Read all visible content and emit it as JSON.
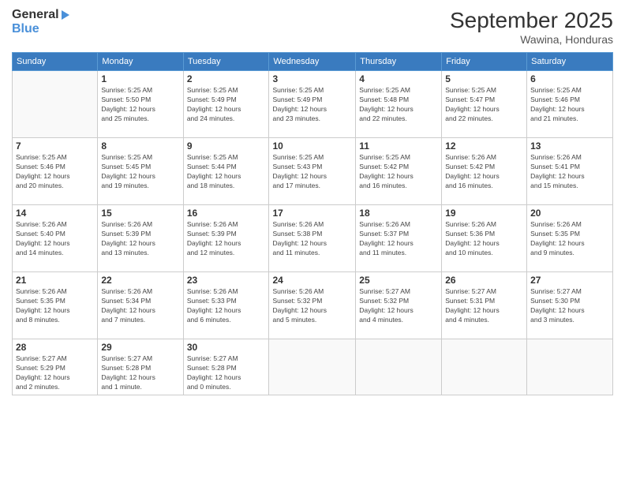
{
  "header": {
    "logo_line1": "General",
    "logo_line2": "Blue",
    "month": "September 2025",
    "location": "Wawina, Honduras"
  },
  "days_of_week": [
    "Sunday",
    "Monday",
    "Tuesday",
    "Wednesday",
    "Thursday",
    "Friday",
    "Saturday"
  ],
  "weeks": [
    [
      {
        "day": "",
        "info": ""
      },
      {
        "day": "1",
        "info": "Sunrise: 5:25 AM\nSunset: 5:50 PM\nDaylight: 12 hours\nand 25 minutes."
      },
      {
        "day": "2",
        "info": "Sunrise: 5:25 AM\nSunset: 5:49 PM\nDaylight: 12 hours\nand 24 minutes."
      },
      {
        "day": "3",
        "info": "Sunrise: 5:25 AM\nSunset: 5:49 PM\nDaylight: 12 hours\nand 23 minutes."
      },
      {
        "day": "4",
        "info": "Sunrise: 5:25 AM\nSunset: 5:48 PM\nDaylight: 12 hours\nand 22 minutes."
      },
      {
        "day": "5",
        "info": "Sunrise: 5:25 AM\nSunset: 5:47 PM\nDaylight: 12 hours\nand 22 minutes."
      },
      {
        "day": "6",
        "info": "Sunrise: 5:25 AM\nSunset: 5:46 PM\nDaylight: 12 hours\nand 21 minutes."
      }
    ],
    [
      {
        "day": "7",
        "info": "Sunrise: 5:25 AM\nSunset: 5:46 PM\nDaylight: 12 hours\nand 20 minutes."
      },
      {
        "day": "8",
        "info": "Sunrise: 5:25 AM\nSunset: 5:45 PM\nDaylight: 12 hours\nand 19 minutes."
      },
      {
        "day": "9",
        "info": "Sunrise: 5:25 AM\nSunset: 5:44 PM\nDaylight: 12 hours\nand 18 minutes."
      },
      {
        "day": "10",
        "info": "Sunrise: 5:25 AM\nSunset: 5:43 PM\nDaylight: 12 hours\nand 17 minutes."
      },
      {
        "day": "11",
        "info": "Sunrise: 5:25 AM\nSunset: 5:42 PM\nDaylight: 12 hours\nand 16 minutes."
      },
      {
        "day": "12",
        "info": "Sunrise: 5:26 AM\nSunset: 5:42 PM\nDaylight: 12 hours\nand 16 minutes."
      },
      {
        "day": "13",
        "info": "Sunrise: 5:26 AM\nSunset: 5:41 PM\nDaylight: 12 hours\nand 15 minutes."
      }
    ],
    [
      {
        "day": "14",
        "info": "Sunrise: 5:26 AM\nSunset: 5:40 PM\nDaylight: 12 hours\nand 14 minutes."
      },
      {
        "day": "15",
        "info": "Sunrise: 5:26 AM\nSunset: 5:39 PM\nDaylight: 12 hours\nand 13 minutes."
      },
      {
        "day": "16",
        "info": "Sunrise: 5:26 AM\nSunset: 5:39 PM\nDaylight: 12 hours\nand 12 minutes."
      },
      {
        "day": "17",
        "info": "Sunrise: 5:26 AM\nSunset: 5:38 PM\nDaylight: 12 hours\nand 11 minutes."
      },
      {
        "day": "18",
        "info": "Sunrise: 5:26 AM\nSunset: 5:37 PM\nDaylight: 12 hours\nand 11 minutes."
      },
      {
        "day": "19",
        "info": "Sunrise: 5:26 AM\nSunset: 5:36 PM\nDaylight: 12 hours\nand 10 minutes."
      },
      {
        "day": "20",
        "info": "Sunrise: 5:26 AM\nSunset: 5:35 PM\nDaylight: 12 hours\nand 9 minutes."
      }
    ],
    [
      {
        "day": "21",
        "info": "Sunrise: 5:26 AM\nSunset: 5:35 PM\nDaylight: 12 hours\nand 8 minutes."
      },
      {
        "day": "22",
        "info": "Sunrise: 5:26 AM\nSunset: 5:34 PM\nDaylight: 12 hours\nand 7 minutes."
      },
      {
        "day": "23",
        "info": "Sunrise: 5:26 AM\nSunset: 5:33 PM\nDaylight: 12 hours\nand 6 minutes."
      },
      {
        "day": "24",
        "info": "Sunrise: 5:26 AM\nSunset: 5:32 PM\nDaylight: 12 hours\nand 5 minutes."
      },
      {
        "day": "25",
        "info": "Sunrise: 5:27 AM\nSunset: 5:32 PM\nDaylight: 12 hours\nand 4 minutes."
      },
      {
        "day": "26",
        "info": "Sunrise: 5:27 AM\nSunset: 5:31 PM\nDaylight: 12 hours\nand 4 minutes."
      },
      {
        "day": "27",
        "info": "Sunrise: 5:27 AM\nSunset: 5:30 PM\nDaylight: 12 hours\nand 3 minutes."
      }
    ],
    [
      {
        "day": "28",
        "info": "Sunrise: 5:27 AM\nSunset: 5:29 PM\nDaylight: 12 hours\nand 2 minutes."
      },
      {
        "day": "29",
        "info": "Sunrise: 5:27 AM\nSunset: 5:28 PM\nDaylight: 12 hours\nand 1 minute."
      },
      {
        "day": "30",
        "info": "Sunrise: 5:27 AM\nSunset: 5:28 PM\nDaylight: 12 hours\nand 0 minutes."
      },
      {
        "day": "",
        "info": ""
      },
      {
        "day": "",
        "info": ""
      },
      {
        "day": "",
        "info": ""
      },
      {
        "day": "",
        "info": ""
      }
    ]
  ]
}
